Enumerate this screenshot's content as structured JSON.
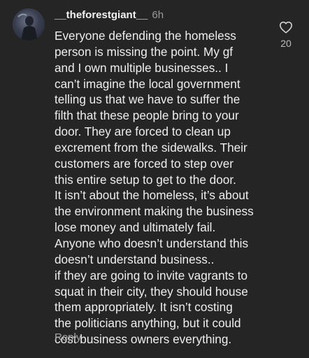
{
  "comment": {
    "username": "__theforestgiant__",
    "timestamp": "6h",
    "lines": [
      "Everyone defending the homeless",
      "person is missing the point. My gf",
      "and I own multiple businesses.. I",
      "can’t imagine the local government",
      "telling us that we have to suffer the",
      "filth that these people bring to your",
      "door. They are forced to clean up",
      "excrement from the sidewalks. Their",
      "customers are forced to step over",
      "this entire setup to get to the door.",
      "It isn’t about the homeless, it’s about",
      "the environment making the business",
      "lose money and ultimately fail.",
      "Anyone who doesn’t understand this",
      "doesn’t understand business..",
      "if they are going to invite vagrants to",
      "squat in their city, they should house",
      "them appropriately. It isn’t costing",
      "the politicians anything, but it could",
      "cost business owners everything."
    ],
    "reply_label": "Reply",
    "like_count": "20",
    "like_icon": "heart-outline-icon",
    "avatar_icon": "user-avatar-photo"
  },
  "colors": {
    "background": "#252525",
    "text": "#eeeeee",
    "muted": "#9a9a9a"
  }
}
